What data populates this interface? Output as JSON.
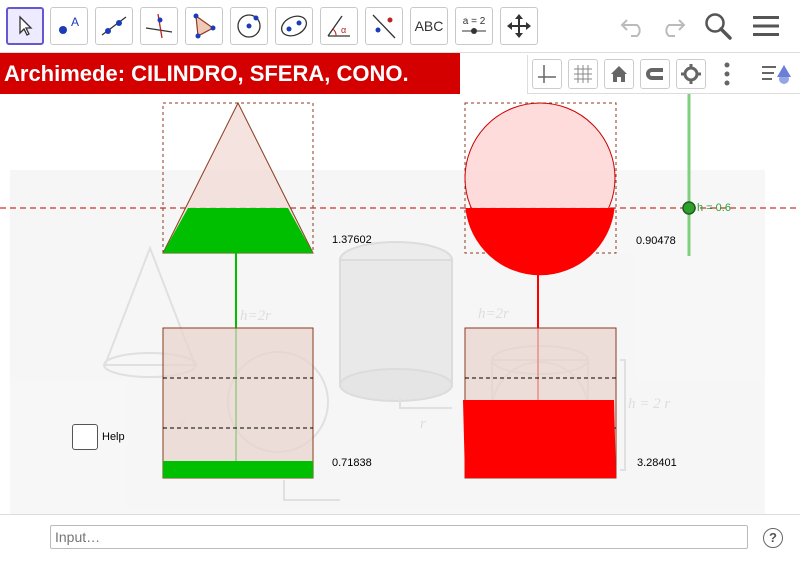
{
  "toolbar": {
    "tools": [
      {
        "name": "move-tool-icon",
        "label": ""
      },
      {
        "name": "point-tool-icon",
        "label": "A"
      },
      {
        "name": "line-tool-icon",
        "label": ""
      },
      {
        "name": "perpendicular-tool-icon",
        "label": ""
      },
      {
        "name": "polygon-tool-icon",
        "label": ""
      },
      {
        "name": "circle-tool-icon",
        "label": ""
      },
      {
        "name": "ellipse-tool-icon",
        "label": ""
      },
      {
        "name": "angle-tool-icon",
        "label": "α"
      },
      {
        "name": "reflect-tool-icon",
        "label": ""
      },
      {
        "name": "text-tool",
        "label": "ABC"
      },
      {
        "name": "slider-tool",
        "label": "a = 2"
      },
      {
        "name": "move-view-tool-icon",
        "label": ""
      }
    ],
    "undo_icon": "undo-icon",
    "redo_icon": "redo-icon",
    "search_icon": "search-icon",
    "menu_icon": "menu-icon"
  },
  "banner": {
    "title": "Archimede: CILINDRO,  SFERA,  CONO."
  },
  "values": {
    "cone_top": "1.37602",
    "sphere_top": "0.90478",
    "cylinder_left": "0.71838",
    "cylinder_right": "3.28401"
  },
  "slider": {
    "label": "h = 0.6",
    "value": 0.6
  },
  "background_labels": {
    "h1": "h=2r",
    "h2": "h=2r",
    "h3": "h = 2 r",
    "r1": "r",
    "r2": "r"
  },
  "checkbox": {
    "label": "Help",
    "checked": false
  },
  "input": {
    "placeholder": "Input…"
  },
  "help_icon": "?",
  "colors": {
    "banner": "#d40000",
    "green": "#00bf00",
    "red": "#ff0000",
    "fill_brown": "#f1dcd6",
    "outline": "#8b3a1f"
  }
}
